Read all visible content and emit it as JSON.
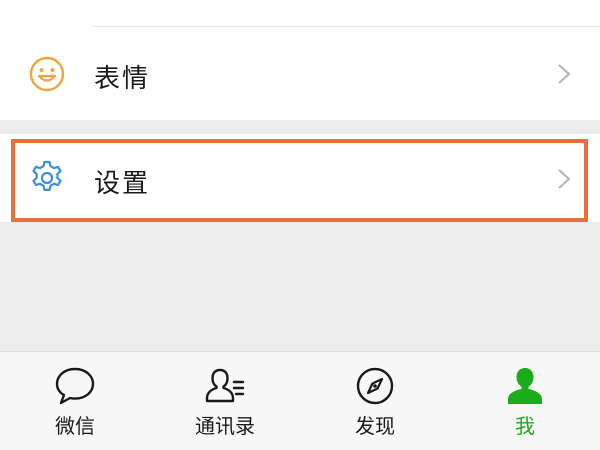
{
  "menu": {
    "emoji_label": "表情",
    "settings_label": "设置"
  },
  "tabbar": {
    "tabs": [
      {
        "label": "微信",
        "icon": "chat-bubble-icon",
        "active": false
      },
      {
        "label": "通讯录",
        "icon": "contacts-icon",
        "active": false
      },
      {
        "label": "发现",
        "icon": "compass-icon",
        "active": false
      },
      {
        "label": "我",
        "icon": "person-icon",
        "active": true
      }
    ]
  },
  "colors": {
    "accent_green": "#1aad19",
    "emoji_icon": "#f0a43c",
    "settings_icon": "#3c8fe0",
    "highlight": "#e8703f"
  }
}
